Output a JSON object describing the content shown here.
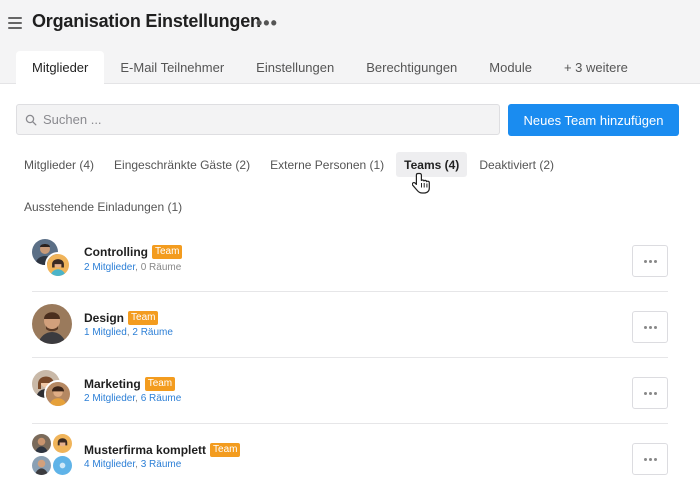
{
  "header": {
    "title": "Organisation Einstellungen",
    "more_label": "•••"
  },
  "tabs": [
    {
      "label": "Mitglieder",
      "active": true
    },
    {
      "label": "E-Mail Teilnehmer",
      "active": false
    },
    {
      "label": "Einstellungen",
      "active": false
    },
    {
      "label": "Berechtigungen",
      "active": false
    },
    {
      "label": "Module",
      "active": false
    },
    {
      "label": "+ 3 weitere",
      "active": false
    }
  ],
  "search": {
    "placeholder": "Suchen ...",
    "value": ""
  },
  "actions": {
    "new_team_label": "Neues Team hinzufügen"
  },
  "filters": [
    {
      "label": "Mitglieder (4)",
      "active": false
    },
    {
      "label": "Eingeschränkte Gäste (2)",
      "active": false
    },
    {
      "label": "Externe Personen (1)",
      "active": false
    },
    {
      "label": "Teams (4)",
      "active": true
    },
    {
      "label": "Deaktiviert (2)",
      "active": false
    },
    {
      "label": "Ausstehende Einladungen (1)",
      "active": false
    }
  ],
  "teams": [
    {
      "name": "Controlling",
      "badge": "Team",
      "members": "2 Mitglieder",
      "rooms": "0 Räume"
    },
    {
      "name": "Design",
      "badge": "Team",
      "members": "1 Mitglied",
      "rooms": "2 Räume"
    },
    {
      "name": "Marketing",
      "badge": "Team",
      "members": "2 Mitglieder",
      "rooms": "6 Räume"
    },
    {
      "name": "Musterfirma komplett",
      "badge": "Team",
      "members": "4 Mitglieder",
      "rooms": "3 Räume"
    }
  ],
  "colors": {
    "accent": "#1a8cf0",
    "badge": "#f39c1f",
    "link": "#2c7fd6"
  },
  "icons": {
    "menu": "hamburger-icon",
    "search": "search-icon",
    "more": "more-horizontal-icon",
    "cursor": "hand-pointer-icon"
  }
}
